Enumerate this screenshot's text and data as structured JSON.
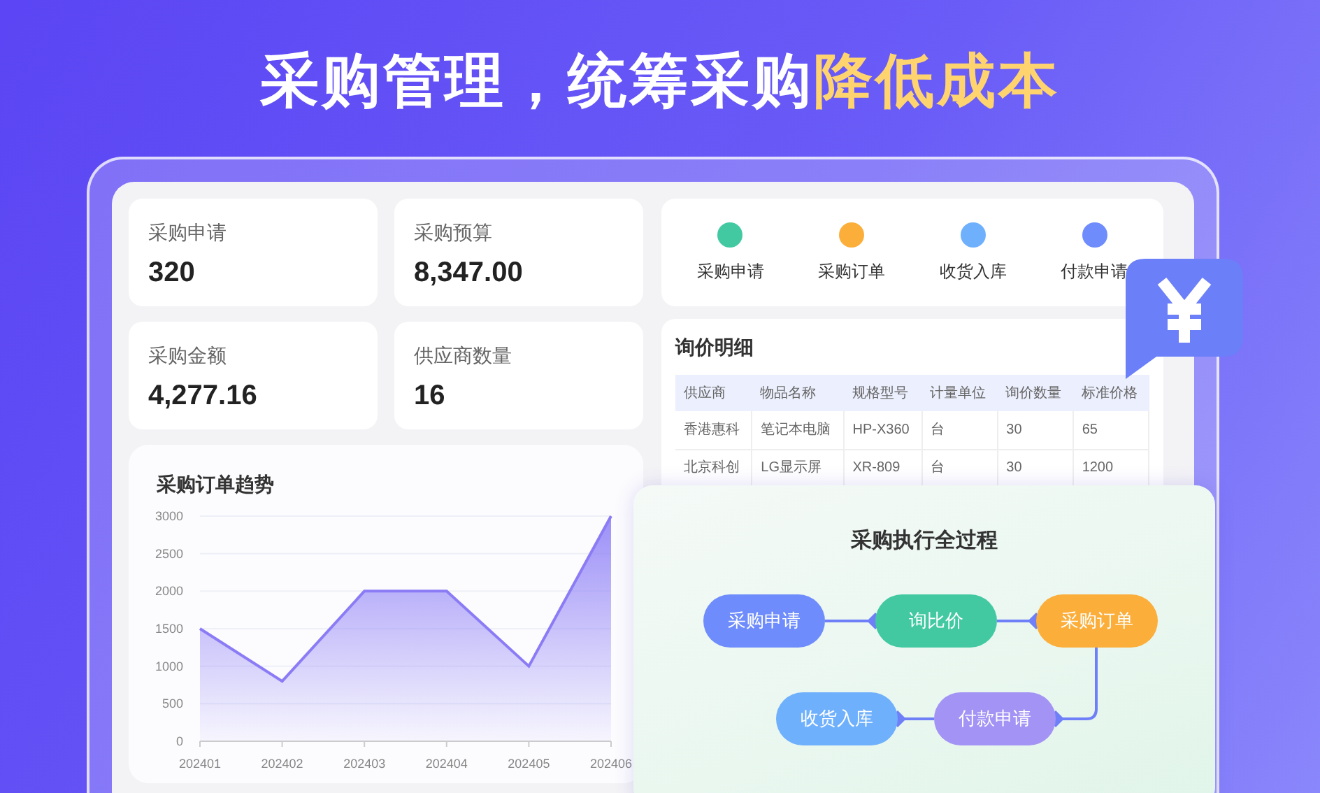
{
  "headline": [
    {
      "text": "采购管理，统筹采购",
      "highlight": false
    },
    {
      "text": "降低成本",
      "highlight": true
    }
  ],
  "stats": [
    {
      "label": "采购申请",
      "value": "320"
    },
    {
      "label": "采购预算",
      "value": "8,347.00"
    },
    {
      "label": "采购金额",
      "value": "4,277.16"
    },
    {
      "label": "供应商数量",
      "value": "16"
    }
  ],
  "legend": [
    {
      "label": "采购申请",
      "color": "#43c9a2"
    },
    {
      "label": "采购订单",
      "color": "#fbae3a"
    },
    {
      "label": "收货入库",
      "color": "#6fb0fd"
    },
    {
      "label": "付款申请",
      "color": "#6e8cfb"
    }
  ],
  "inquiry": {
    "title": "询价明细",
    "columns": [
      "供应商",
      "物品名称",
      "规格型号",
      "计量单位",
      "询价数量",
      "标准价格"
    ],
    "rows": [
      [
        "香港惠科",
        "笔记本电脑",
        "HP-X360",
        "台",
        "30",
        "65"
      ],
      [
        "北京科创",
        "LG显示屏",
        "XR-809",
        "台",
        "30",
        "1200"
      ]
    ]
  },
  "trend": {
    "title": "采购订单趋势",
    "chart_data": {
      "type": "area",
      "categories": [
        "202401",
        "202402",
        "202403",
        "202404",
        "202405",
        "202406"
      ],
      "series": [
        {
          "color": "#8b7cf6",
          "values": [
            1500,
            800,
            2000,
            2000,
            1000,
            3000
          ]
        }
      ],
      "grid": true,
      "ylim": [
        0,
        3000
      ],
      "yticks": [
        0,
        500,
        1000,
        1500,
        2000,
        2500,
        3000
      ]
    }
  },
  "process": {
    "title": "采购执行全过程",
    "steps": [
      {
        "label": "采购申请",
        "color": "#6e8cfb"
      },
      {
        "label": "询比价",
        "color": "#43c9a2"
      },
      {
        "label": "采购订单",
        "color": "#fbae3a"
      },
      {
        "label": "付款申请",
        "color": "#a393f5"
      },
      {
        "label": "收货入库",
        "color": "#6fb0fd"
      }
    ]
  }
}
